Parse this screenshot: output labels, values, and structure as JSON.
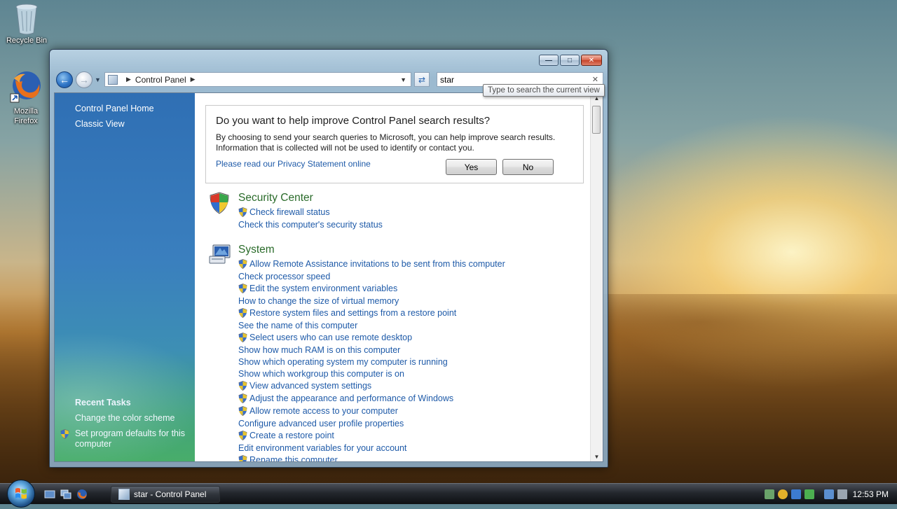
{
  "desktop": {
    "icons": [
      {
        "label": "Recycle Bin"
      },
      {
        "label": "Mozilla Firefox"
      }
    ]
  },
  "window": {
    "address": {
      "root": "Control Panel"
    },
    "search": {
      "value": "star",
      "tooltip": "Type to search the current view"
    },
    "sidebar": {
      "links": [
        "Control Panel Home",
        "Classic View"
      ],
      "recent_heading": "Recent Tasks",
      "recent_tasks": [
        "Change the color scheme",
        "Set program defaults for this computer"
      ]
    },
    "infobox": {
      "title": "Do you want to help improve Control Panel search results?",
      "text": "By choosing to send your search queries to Microsoft, you can help improve search results. Information that is collected will not be used to identify or contact you.",
      "link": "Please read our Privacy Statement online",
      "yes": "Yes",
      "no": "No"
    },
    "results": [
      {
        "title": "Security Center",
        "tasks": [
          {
            "label": "Check firewall status",
            "shield": true
          },
          {
            "label": "Check this computer's security status",
            "shield": false
          }
        ]
      },
      {
        "title": "System",
        "tasks": [
          {
            "label": "Allow Remote Assistance invitations to be sent from this computer",
            "shield": true
          },
          {
            "label": "Check processor speed",
            "shield": false
          },
          {
            "label": "Edit the system environment variables",
            "shield": true
          },
          {
            "label": "How to change the size of virtual memory",
            "shield": false
          },
          {
            "label": "Restore system files and settings from a restore point",
            "shield": true
          },
          {
            "label": "See the name of this computer",
            "shield": false
          },
          {
            "label": "Select users who can use remote desktop",
            "shield": true
          },
          {
            "label": "Show how much RAM is on this computer",
            "shield": false
          },
          {
            "label": "Show which operating system my computer is running",
            "shield": false
          },
          {
            "label": "Show which workgroup this computer is on",
            "shield": false
          },
          {
            "label": "View advanced system settings",
            "shield": true
          },
          {
            "label": "Adjust the appearance and performance of Windows",
            "shield": true
          },
          {
            "label": "Allow remote access to your computer",
            "shield": true
          },
          {
            "label": "Configure advanced user profile properties",
            "shield": false
          },
          {
            "label": "Create a restore point",
            "shield": true
          },
          {
            "label": "Edit environment variables for your account",
            "shield": false
          },
          {
            "label": "Rename this computer",
            "shield": true
          }
        ]
      }
    ]
  },
  "taskbar": {
    "active_task": "star - Control Panel",
    "clock": "12:53 PM"
  }
}
